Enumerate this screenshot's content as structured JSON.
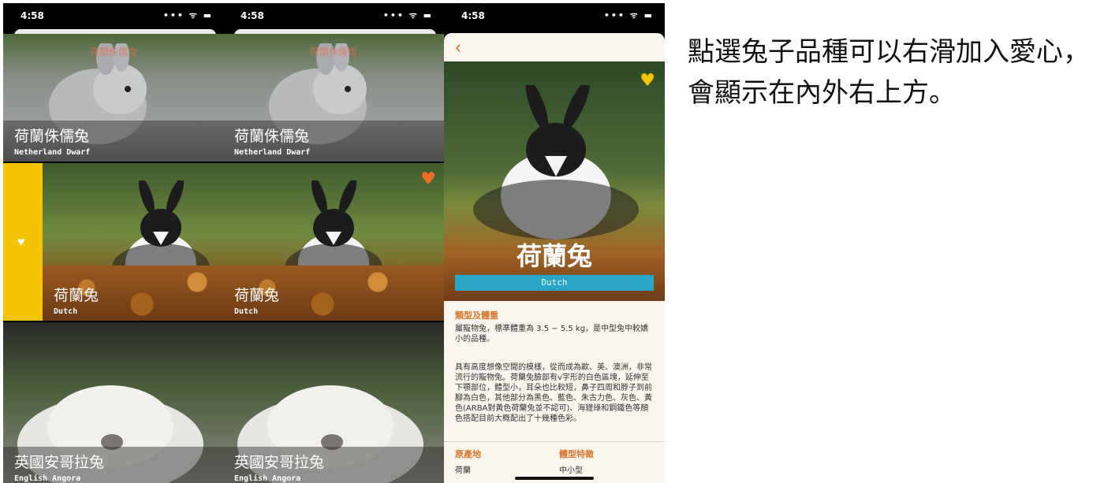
{
  "status": {
    "time": "4:58",
    "signal_icons": "••• ᯤ ▬"
  },
  "breeds": [
    {
      "zh": "荷蘭侏儒兔",
      "en": "Netherland Dwarf"
    },
    {
      "zh": "荷蘭兔",
      "en": "Dutch"
    },
    {
      "zh": "英國安哥拉兔",
      "en": "English Angora"
    }
  ],
  "overlay_text": "荷蘭侏儒兔",
  "swipe_action": {
    "icon": "heart-icon",
    "color": "#f5c400"
  },
  "favorite_color": "#f06a2a",
  "detail": {
    "back_icon": "chevron-left-icon",
    "title": "荷蘭兔",
    "subtitle": "Dutch",
    "type_heading": "類型及體重",
    "type_text": "屬寵物兔，標準體重為 3.5 − 5.5 kg，是中型兔中較嬌小的品種。",
    "desc_text": "具有高度想像空間的模樣，從而成為歐、美、澳洲，非常流行的寵物兔。荷蘭兔臉部有v字形的白色區塊，延伸至下顎部位，體型小，耳朵也比較短，鼻子四周和脖子到前腳為白色，其他部分為黑色、藍色、朱古力色、灰色、黃色(ARBA對黃色荷蘭兔並不認可)、海貍綠和鋼鐵色等顏色搭配目前大概配出了十幾種色彩。",
    "origin_heading": "原產地",
    "origin_value": "荷蘭",
    "body_heading": "體型特徵",
    "body_value": "中小型"
  },
  "caption": "點選兔子品種可以右滑加入愛心，會顯示在內外右上方。"
}
